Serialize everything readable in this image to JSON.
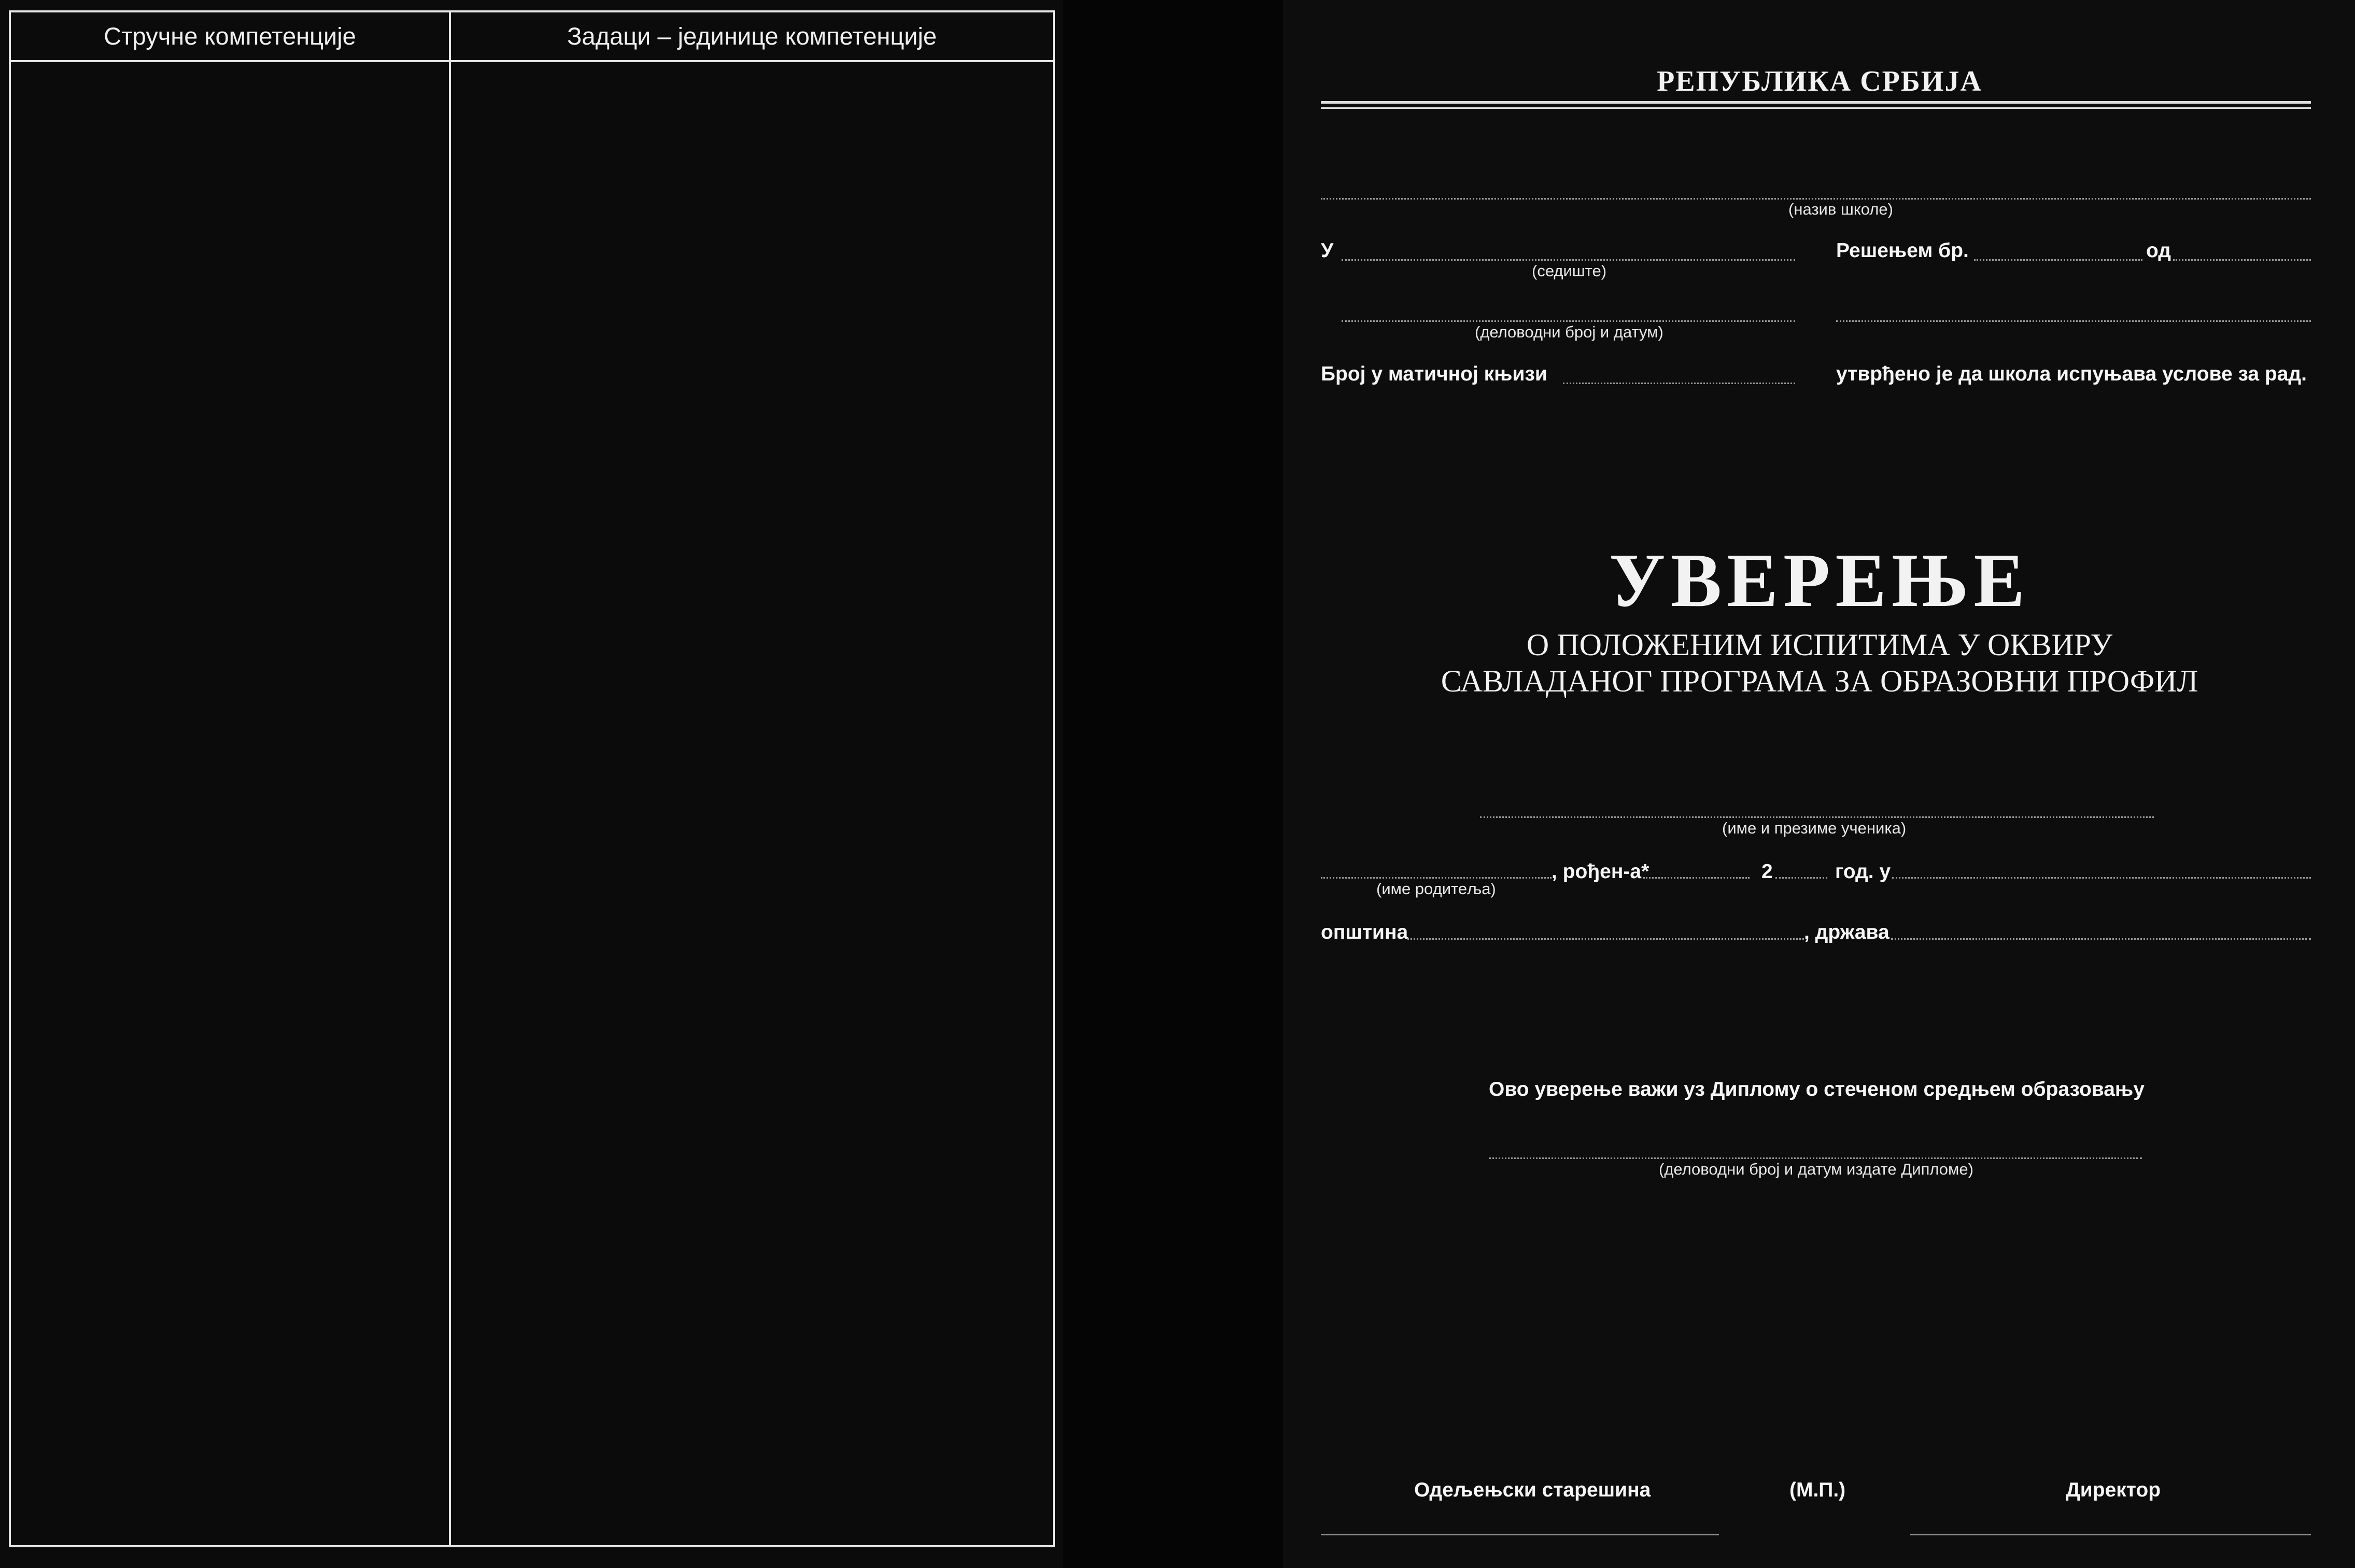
{
  "left_page": {
    "col1_header": "Стручне компетенције",
    "col2_header": "Задаци – јединице компетенције"
  },
  "right_page": {
    "republic": "РЕПУБЛИКА СРБИЈА",
    "school_name_caption": "(назив школе)",
    "u_label": "У",
    "seat_caption": "(седиште)",
    "decision_label": "Решењем бр.",
    "od_label": "од",
    "ref_caption": "(деловодни број и датум)",
    "register_label": "Број у матичној књизи",
    "established_text": "утврђено је да школа испуњава услове за рад.",
    "title": "УВЕРЕЊЕ",
    "subtitle_line1": "О ПОЛОЖЕНИМ ИСПИТИМА У ОКВИРУ",
    "subtitle_line2": "САВЛАДАНОГ ПРОГРАМА ЗА ОБРАЗОВНИ ПРОФИЛ",
    "student_caption": "(име и презиме ученика)",
    "born_label": ", рођен-а*",
    "year_prefix": "2",
    "year_label": "год. у",
    "parent_caption": "(име родитеља)",
    "municipality_label": "општина",
    "state_label": ", држава",
    "validity_text": "Ово уверење важи уз Диплому о стеченом средњем образовању",
    "diploma_caption": "(деловодни број и датум издате Дипломе)",
    "class_teacher_label": "Одељењски старешина",
    "seal_label": "(М.П.)",
    "director_label": "Директор"
  }
}
